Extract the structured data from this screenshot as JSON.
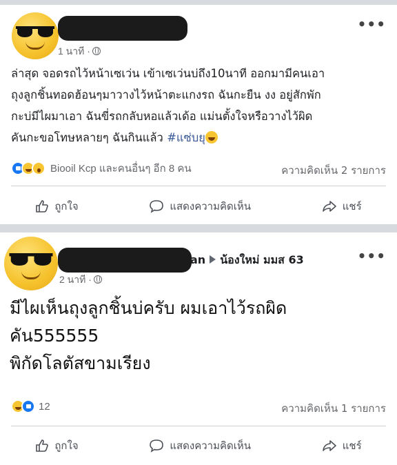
{
  "post1": {
    "time": "1 นาที ·",
    "text_lines": [
      "ล่าสุด จอดรถไว้หน้าเซเว่น เข้าเซเว่นบ่ถึง10นาที ออกมามีคนเอา",
      "ถุงลูกชิ้นทอดฮ้อนๆมาวางไว้หน้าตะแกงรถ ฉันกะยืน งง อยู่สักพัก",
      "กะบ่มีไผมาเอา ฉันขี่รถกลับหอแล้วเด้อ แม่นตั้งใจหรือวางไว้ผิด",
      "คันกะขอโทษหลายๆ ฉันกินแล้ว"
    ],
    "hashtag": "#แซ่บยุ",
    "reactions_text": "Biooil Kcp และคนอื่นๆ อีก 8 คน",
    "comments_text": "ความคิดเห็น 2 รายการ"
  },
  "post2": {
    "name_suffix": "an",
    "group": "น้องใหม่ มมส 63",
    "time": "2 นาที ·",
    "text_lines": [
      "มีไผเห็นถุงลูกชิ้นบ่ครับ ผมเอาไว้รถผิด",
      "คัน555555",
      "พิกัดโลตัสขามเรียง"
    ],
    "reactions_count": "12",
    "comments_text": "ความคิดเห็น 1 รายการ"
  },
  "actions": {
    "like": "ถูกใจ",
    "comment": "แสดงความคิดเห็น",
    "share": "แชร์"
  },
  "icons": [
    "like-icon",
    "comment-icon",
    "share-icon",
    "globe-icon",
    "more-icon"
  ],
  "colors": {
    "link": "#385898",
    "like_blue": "#1877f2",
    "muted": "#65676b"
  }
}
